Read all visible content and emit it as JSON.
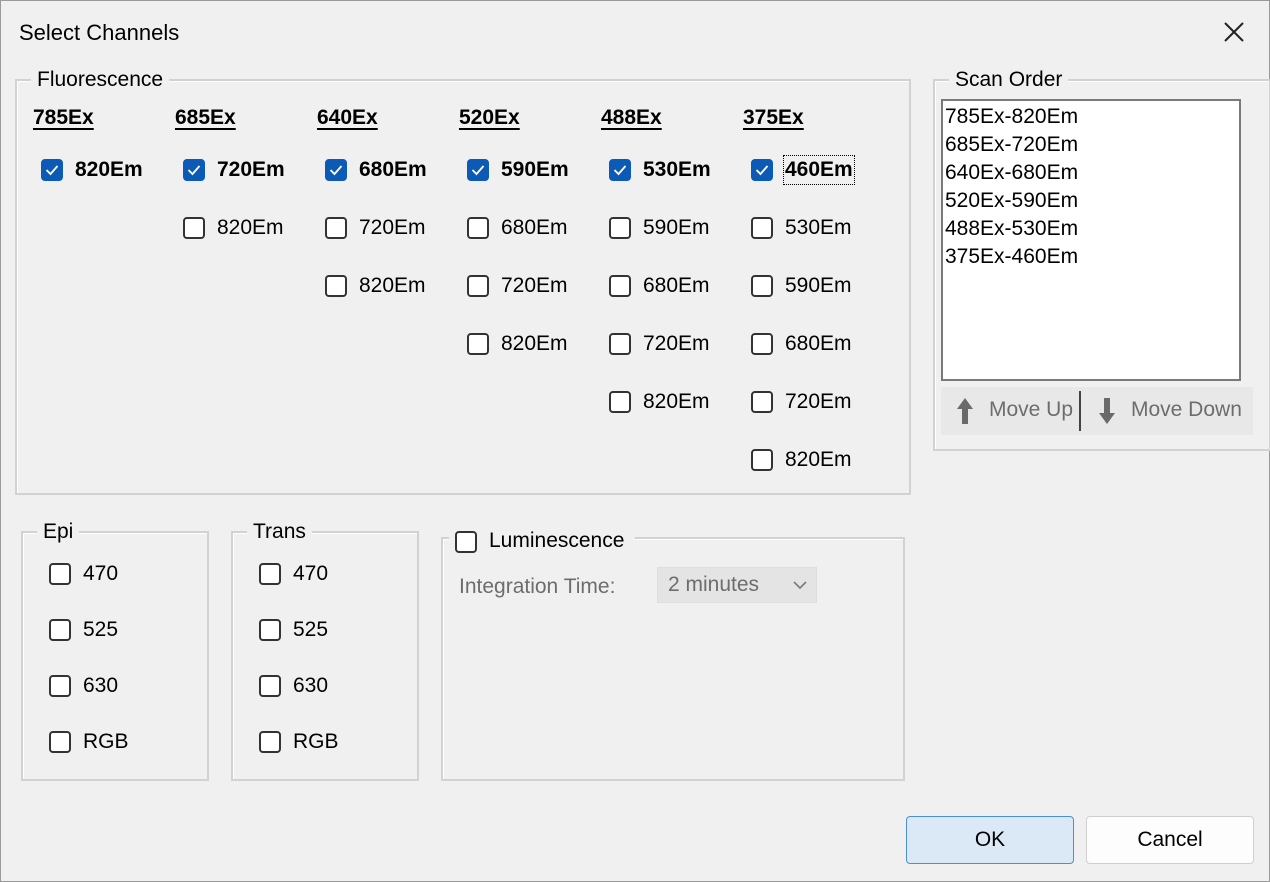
{
  "window": {
    "title": "Select Channels"
  },
  "fluorescence": {
    "legend": "Fluorescence",
    "columns": [
      {
        "ex": "785Ex",
        "items": [
          {
            "label": "820Em",
            "checked": true
          }
        ]
      },
      {
        "ex": "685Ex",
        "items": [
          {
            "label": "720Em",
            "checked": true
          },
          {
            "label": "820Em",
            "checked": false
          }
        ]
      },
      {
        "ex": "640Ex",
        "items": [
          {
            "label": "680Em",
            "checked": true
          },
          {
            "label": "720Em",
            "checked": false
          },
          {
            "label": "820Em",
            "checked": false
          }
        ]
      },
      {
        "ex": "520Ex",
        "items": [
          {
            "label": "590Em",
            "checked": true
          },
          {
            "label": "680Em",
            "checked": false
          },
          {
            "label": "720Em",
            "checked": false
          },
          {
            "label": "820Em",
            "checked": false
          }
        ]
      },
      {
        "ex": "488Ex",
        "items": [
          {
            "label": "530Em",
            "checked": true
          },
          {
            "label": "590Em",
            "checked": false
          },
          {
            "label": "680Em",
            "checked": false
          },
          {
            "label": "720Em",
            "checked": false
          },
          {
            "label": "820Em",
            "checked": false
          }
        ]
      },
      {
        "ex": "375Ex",
        "items": [
          {
            "label": "460Em",
            "checked": true
          },
          {
            "label": "530Em",
            "checked": false
          },
          {
            "label": "590Em",
            "checked": false
          },
          {
            "label": "680Em",
            "checked": false
          },
          {
            "label": "720Em",
            "checked": false
          },
          {
            "label": "820Em",
            "checked": false
          }
        ]
      }
    ]
  },
  "scan_order": {
    "legend": "Scan Order",
    "items": [
      "785Ex-820Em",
      "685Ex-720Em",
      "640Ex-680Em",
      "520Ex-590Em",
      "488Ex-530Em",
      "375Ex-460Em"
    ],
    "move_up": "Move Up",
    "move_down": "Move Down"
  },
  "epi": {
    "legend": "Epi",
    "items": [
      {
        "label": "470",
        "checked": false
      },
      {
        "label": "525",
        "checked": false
      },
      {
        "label": "630",
        "checked": false
      },
      {
        "label": "RGB",
        "checked": false
      }
    ]
  },
  "trans": {
    "legend": "Trans",
    "items": [
      {
        "label": "470",
        "checked": false
      },
      {
        "label": "525",
        "checked": false
      },
      {
        "label": "630",
        "checked": false
      },
      {
        "label": "RGB",
        "checked": false
      }
    ]
  },
  "luminescence": {
    "legend": "Luminescence",
    "checked": false,
    "integration_label": "Integration Time:",
    "integration_value": "2 minutes"
  },
  "buttons": {
    "ok": "OK",
    "cancel": "Cancel"
  },
  "colors": {
    "accent": "#0a5ab6",
    "ok_bg": "#dbe9f6",
    "ok_border": "#4a90d6",
    "disabled_text": "#6d6d6d"
  }
}
